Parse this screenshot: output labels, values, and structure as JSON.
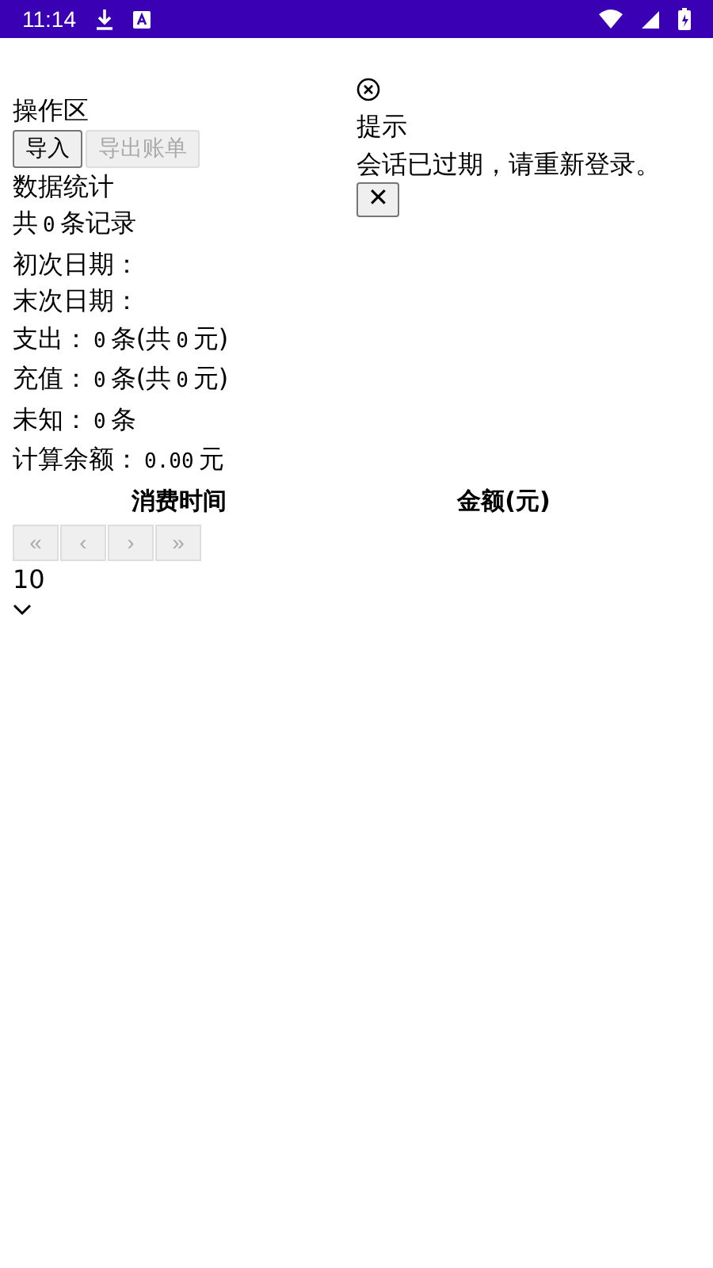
{
  "status_bar": {
    "time": "11:14"
  },
  "operations": {
    "title": "操作区",
    "buttons": [
      {
        "label": "导入",
        "disabled": false
      },
      {
        "label": "导出账单",
        "disabled": true
      }
    ]
  },
  "stats": {
    "title": "数据统计",
    "lines": [
      [
        {
          "kind": "label",
          "text": "共"
        },
        {
          "kind": "code",
          "text": "0"
        },
        {
          "kind": "label",
          "text": "条记录"
        }
      ],
      [
        {
          "kind": "label",
          "text": "初次日期："
        }
      ],
      [
        {
          "kind": "label",
          "text": "末次日期："
        }
      ],
      [
        {
          "kind": "label",
          "text": "支出："
        },
        {
          "kind": "code",
          "text": "0"
        },
        {
          "kind": "label",
          "text": "条(共"
        },
        {
          "kind": "code",
          "text": "0"
        },
        {
          "kind": "label",
          "text": "元)"
        }
      ],
      [
        {
          "kind": "label",
          "text": "充值："
        },
        {
          "kind": "code",
          "text": "0"
        },
        {
          "kind": "label",
          "text": "条(共"
        },
        {
          "kind": "code",
          "text": "0"
        },
        {
          "kind": "label",
          "text": "元)"
        }
      ],
      [
        {
          "kind": "label",
          "text": "未知："
        },
        {
          "kind": "code",
          "text": "0"
        },
        {
          "kind": "label",
          "text": "条"
        }
      ],
      [
        {
          "kind": "label",
          "text": "计算余额："
        },
        {
          "kind": "code",
          "text": "0.00"
        },
        {
          "kind": "label",
          "text": "元"
        }
      ]
    ]
  },
  "notice": {
    "title": "提示",
    "message": "会话已过期，请重新登录。",
    "close_button": "✕"
  },
  "table": {
    "columns": [
      "消费时间",
      "金额(元)"
    ]
  },
  "pagination": {
    "buttons": [
      {
        "label": "«",
        "disabled": true
      },
      {
        "label": "‹",
        "disabled": true
      },
      {
        "label": "›",
        "disabled": true
      },
      {
        "label": "»",
        "disabled": true
      }
    ]
  },
  "page_size": {
    "value": "10"
  }
}
